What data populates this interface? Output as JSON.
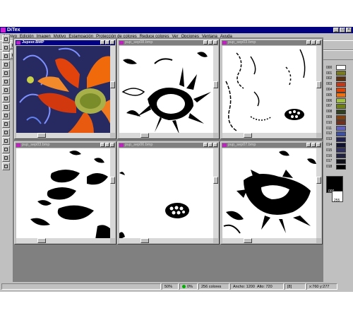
{
  "app": {
    "title": "DiTex"
  },
  "menu": [
    "Archivo",
    "Edición",
    "Imagen",
    "Motivo",
    "Estampación",
    "Protección de colores",
    "Reduce colores",
    "Ver",
    "Opciones",
    "Ventana",
    "Ayuda"
  ],
  "windows": [
    {
      "title": "Jupeer.BMP",
      "active": true
    },
    {
      "title": "pup_sep08.bmp",
      "active": false
    },
    {
      "title": "pup_sep03.bmp",
      "active": false
    },
    {
      "title": "pup_sep03.bmp",
      "active": false
    },
    {
      "title": "pup_sep06.bmp",
      "active": false
    },
    {
      "title": "pup_sep07.bmp",
      "active": false
    }
  ],
  "palette": [
    {
      "id": "000",
      "color": "#ffffff"
    },
    {
      "id": "001",
      "color": "#7a7a20"
    },
    {
      "id": "002",
      "color": "#5a3010"
    },
    {
      "id": "003",
      "color": "#c03818"
    },
    {
      "id": "004",
      "color": "#e04000"
    },
    {
      "id": "005",
      "color": "#f07010"
    },
    {
      "id": "006",
      "color": "#a0c040"
    },
    {
      "id": "007",
      "color": "#708010"
    },
    {
      "id": "008",
      "color": "#304020"
    },
    {
      "id": "009",
      "color": "#804010"
    },
    {
      "id": "010",
      "color": "#703020"
    },
    {
      "id": "011",
      "color": "#6060c0"
    },
    {
      "id": "012",
      "color": "#4050a0"
    },
    {
      "id": "013",
      "color": "#202050"
    },
    {
      "id": "014",
      "color": "#101030"
    },
    {
      "id": "015",
      "color": "#303060"
    },
    {
      "id": "016",
      "color": "#202040"
    },
    {
      "id": "017",
      "color": "#101018"
    },
    {
      "id": "018",
      "color": "#000000"
    }
  ],
  "selected_colors": {
    "foreground": "000",
    "background": "255"
  },
  "status": {
    "zoom": "50%",
    "selection": "0%",
    "colors": "256 colores",
    "width": "Ancho: 1200",
    "height": "Alto: 720",
    "mode": "[8]",
    "coords": "x:760 y:277"
  },
  "accent": "#000080"
}
